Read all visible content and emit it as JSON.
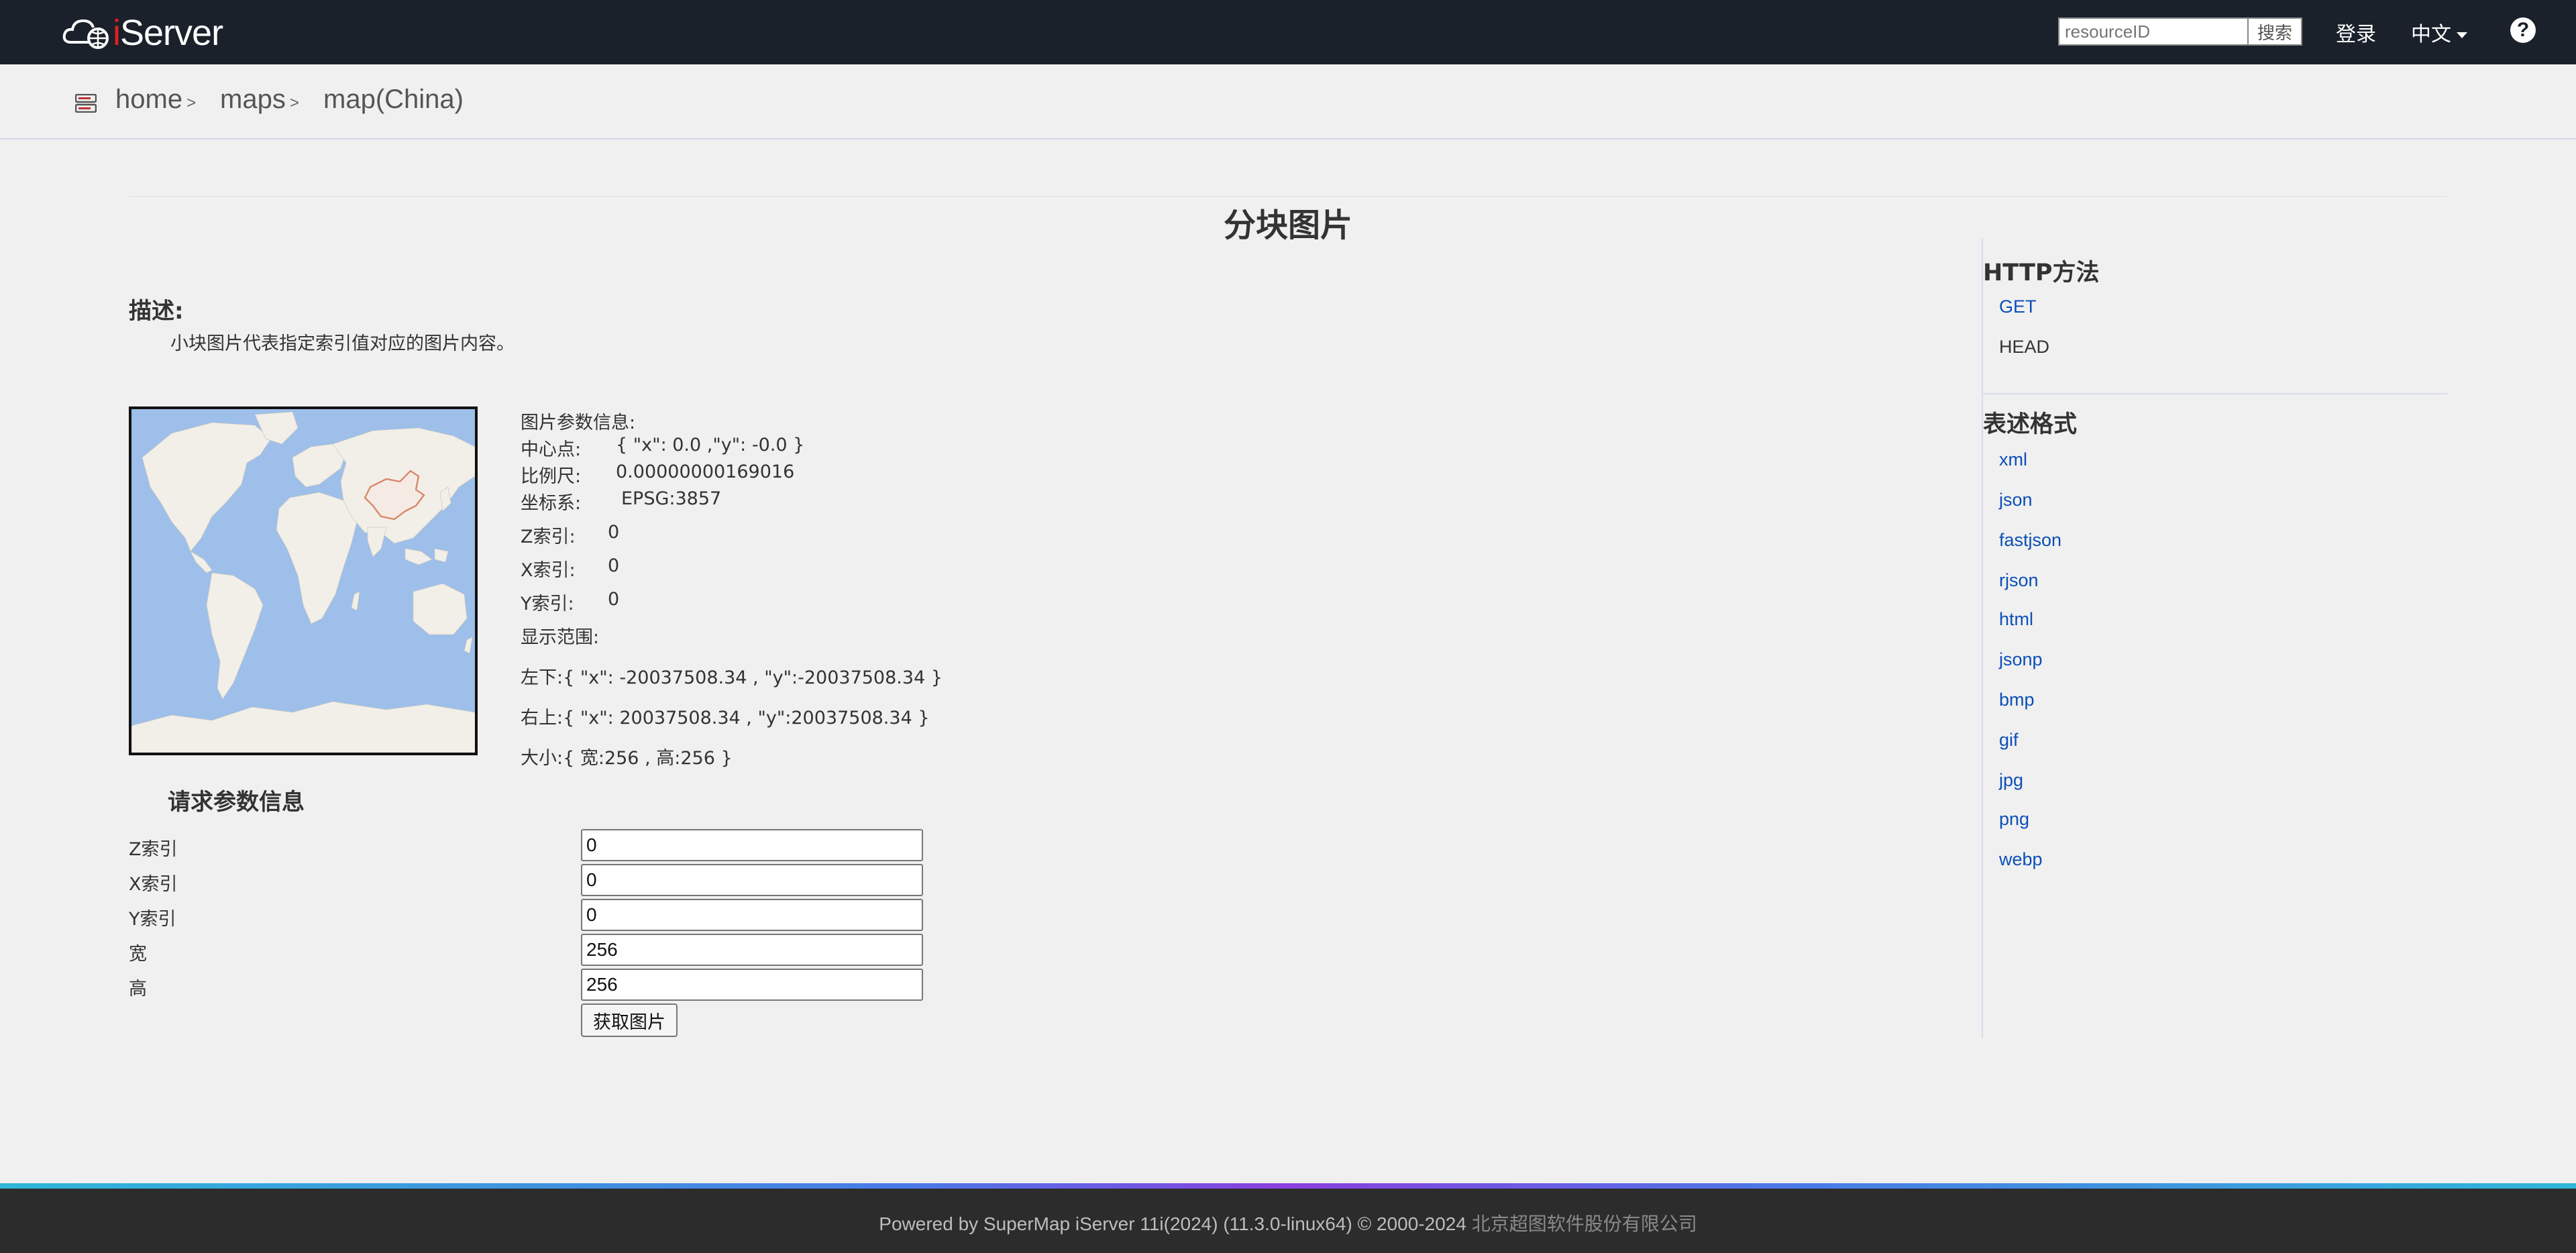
{
  "navbar": {
    "brand": {
      "prefix": "i",
      "name": "Server"
    },
    "search_placeholder": "resourceID",
    "search_button": "搜索",
    "login": "登录",
    "language": "中文",
    "help": "?"
  },
  "breadcrumb": {
    "items": [
      {
        "label": "home",
        "sep": ">"
      },
      {
        "label": "maps",
        "sep": ">"
      },
      {
        "label": "map(China)",
        "sep": ""
      }
    ]
  },
  "main": {
    "title": "分块图片",
    "description_title": "描述:",
    "description_text": "小块图片代表指定索引值对应的图片内容。",
    "image_info": {
      "heading": "图片参数信息:",
      "center_label": "中心点:",
      "center_value": "{ \"x\": 0.0 ,\"y\": -0.0 }",
      "scale_label": "比例尺:",
      "scale_value": "0.00000000169016",
      "crs_label": "坐标系:",
      "crs_value": "EPSG:3857",
      "z_label": "Z索引:",
      "z_value": "0",
      "x_label": "X索引:",
      "x_value": "0",
      "y_label": "Y索引:",
      "y_value": "0",
      "bounds_label": "显示范围:",
      "lower_left": "左下:{ \"x\": -20037508.34 , \"y\":-20037508.34 }",
      "upper_right": "右上:{ \"x\": 20037508.34 , \"y\":20037508.34 }",
      "size": "大小:{ 宽:256 , 高:256 }"
    },
    "request": {
      "title": "请求参数信息",
      "fields": [
        {
          "label": "Z索引",
          "value": "0"
        },
        {
          "label": "X索引",
          "value": "0"
        },
        {
          "label": "Y索引",
          "value": "0"
        },
        {
          "label": "宽",
          "value": "256"
        },
        {
          "label": "高",
          "value": "256"
        }
      ],
      "submit": "获取图片"
    }
  },
  "sidebar": {
    "http_title": "HTTP方法",
    "http_methods": [
      {
        "label": "GET",
        "link": true
      },
      {
        "label": "HEAD",
        "link": false
      }
    ],
    "format_title": "表述格式",
    "formats": [
      "xml",
      "json",
      "fastjson",
      "rjson",
      "html",
      "jsonp",
      "bmp",
      "gif",
      "jpg",
      "png",
      "webp"
    ]
  },
  "footer": {
    "text": "Powered by SuperMap iServer 11i(2024) (11.3.0-linux64) © 2000-2024 ",
    "company": "北京超图软件股份有限公司"
  },
  "colors": {
    "navbar": "#1a212b",
    "link": "#0b4fb8",
    "ocean": "#9dbfe9",
    "land": "#f2efe9",
    "china_outline": "#d8886a"
  }
}
